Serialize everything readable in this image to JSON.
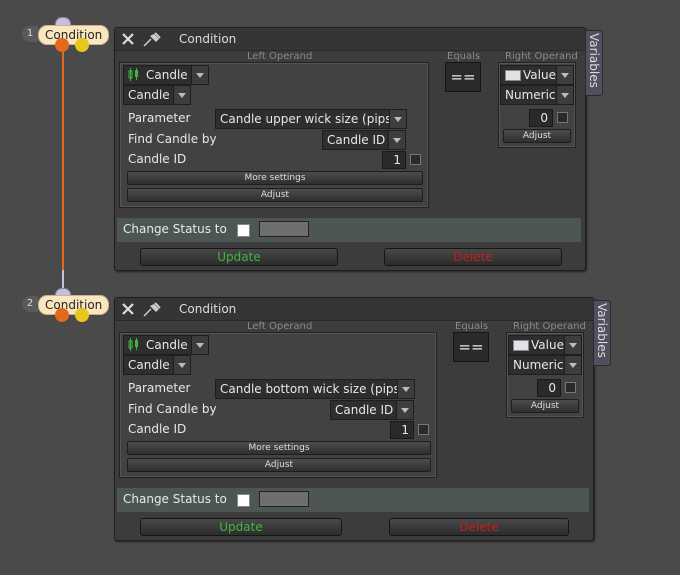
{
  "colors": {
    "connector": "#e36a1d",
    "update": "#3db83d",
    "delete": "#c21e1e"
  },
  "nodes": [
    {
      "number": "1",
      "label": "Condition",
      "title": "Condition",
      "variables_tab": "Variables",
      "left_operand_label": "Left Operand",
      "left_source": "Candle",
      "left_type": "Candle",
      "parameter_label": "Parameter",
      "parameter_value": "Candle upper wick size (pips)",
      "find_by_label": "Find Candle by",
      "find_by_value": "Candle ID",
      "candle_id_label": "Candle ID",
      "candle_id_value": "1",
      "more_settings": "More settings",
      "adjust": "Adjust",
      "equals_label": "Equals",
      "operator": "==",
      "right_operand_label": "Right Operand",
      "right_source": "Value",
      "right_type": "Numeric",
      "right_value": "0",
      "right_adjust": "Adjust",
      "change_status_label": "Change Status to",
      "update_label": "Update",
      "delete_label": "Delete"
    },
    {
      "number": "2",
      "label": "Condition",
      "title": "Condition",
      "variables_tab": "Variables",
      "left_operand_label": "Left Operand",
      "left_source": "Candle",
      "left_type": "Candle",
      "parameter_label": "Parameter",
      "parameter_value": "Candle bottom wick size (pips)",
      "find_by_label": "Find Candle by",
      "find_by_value": "Candle ID",
      "candle_id_label": "Candle ID",
      "candle_id_value": "1",
      "more_settings": "More settings",
      "adjust": "Adjust",
      "equals_label": "Equals",
      "operator": "==",
      "right_operand_label": "Right Operand",
      "right_source": "Value",
      "right_type": "Numeric",
      "right_value": "0",
      "right_adjust": "Adjust",
      "change_status_label": "Change Status to",
      "update_label": "Update",
      "delete_label": "Delete"
    }
  ]
}
